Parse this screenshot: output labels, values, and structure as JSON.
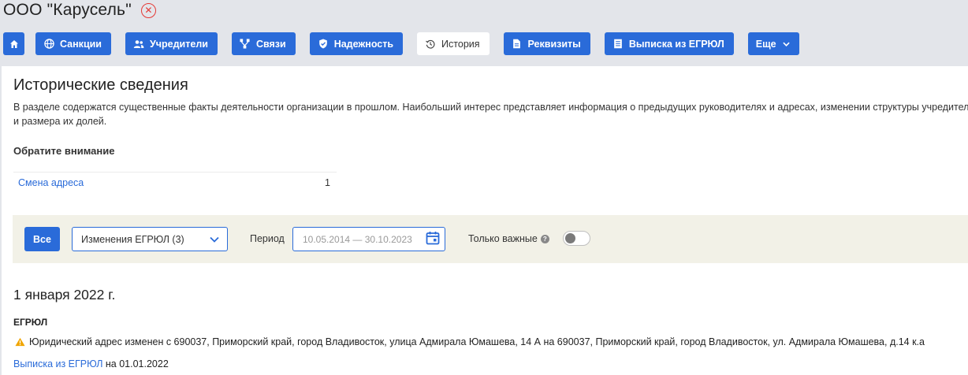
{
  "company": {
    "title": "ООО \"Карусель\"",
    "close_icon": "close-circle-icon",
    "close_color": "#e53935"
  },
  "nav": {
    "accent": "#2a6bd9",
    "tabs": [
      {
        "label": "",
        "icon": "home-icon"
      },
      {
        "label": "Санкции",
        "icon": "globe-icon"
      },
      {
        "label": "Учредители",
        "icon": "people-icon"
      },
      {
        "label": "Связи",
        "icon": "network-icon"
      },
      {
        "label": "Надежность",
        "icon": "shield-icon"
      },
      {
        "label": "История",
        "icon": "history-icon",
        "active": true
      },
      {
        "label": "Реквизиты",
        "icon": "document-icon"
      },
      {
        "label": "Выписка из ЕГРЮЛ",
        "icon": "register-icon"
      },
      {
        "label": "Еще",
        "icon": "chevron-down-icon"
      }
    ]
  },
  "section": {
    "title": "Исторические сведения",
    "description": "В разделе содержатся существенные факты деятельности организации в прошлом. Наибольший интерес представляет информация о предыдущих руководителях и адресах, изменении структуры учредителей и размера их долей."
  },
  "notice": {
    "title": "Обратите внимание",
    "items": [
      {
        "label": "Смена адреса",
        "count": "1"
      }
    ]
  },
  "filters": {
    "all_label": "Все",
    "type_select": {
      "value": "Изменения ЕГРЮЛ (3)"
    },
    "period_label": "Период",
    "period_value": "10.05.2014 — 30.10.2023",
    "important_label": "Только важные",
    "important_on": false
  },
  "events": [
    {
      "date": "1 января 2022 г.",
      "source": "ЕГРЮЛ",
      "text": "Юридический адрес изменен с 690037, Приморский край, город Владивосток, улица Адмирала Юмашева, 14 А на 690037, Приморский край, город Владивосток, ул. Адмирала Юмашева, д.14 к.а",
      "warning_color": "#f0a500",
      "extract_link": "Выписка из ЕГРЮЛ",
      "extract_suffix": " на 01.01.2022"
    }
  ]
}
